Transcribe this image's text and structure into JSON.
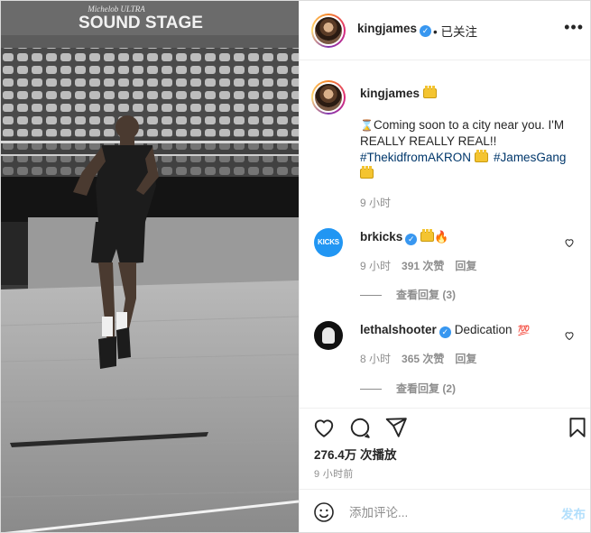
{
  "media": {
    "sign_small": "Michelob ULTRA",
    "sign_large": "SOUND STAGE"
  },
  "header": {
    "username": "kingjames",
    "follow_text": "• 已关注",
    "more_label": "•••"
  },
  "caption": {
    "username": "kingjames",
    "text_main": "Coming soon to a city near you. I'M REALLY REALLY REAL!!",
    "hashtag1": "#ThekidfromAKRON",
    "hashtag2": "#JamesGang",
    "time": "9 小时"
  },
  "comments": [
    {
      "username": "brkicks",
      "avatar_text": "KICKS",
      "time": "9 小时",
      "likes": "391 次赞",
      "reply": "回复",
      "view_replies": "查看回复 (3)"
    },
    {
      "username": "lethalshooter",
      "body": "Dedication",
      "badge": "💯",
      "time": "8 小时",
      "likes": "365 次赞",
      "reply": "回复",
      "view_replies": "查看回复 (2)"
    }
  ],
  "footer": {
    "views": "276.4万 次播放",
    "age": "9 小时前",
    "comment_placeholder": "添加评论...",
    "post_label": "发布"
  },
  "colors": {
    "verified": "#3897f0",
    "hashtag": "#00376b",
    "secondary_text": "#8e8e8e",
    "post_button_disabled": "#b2dffc"
  }
}
